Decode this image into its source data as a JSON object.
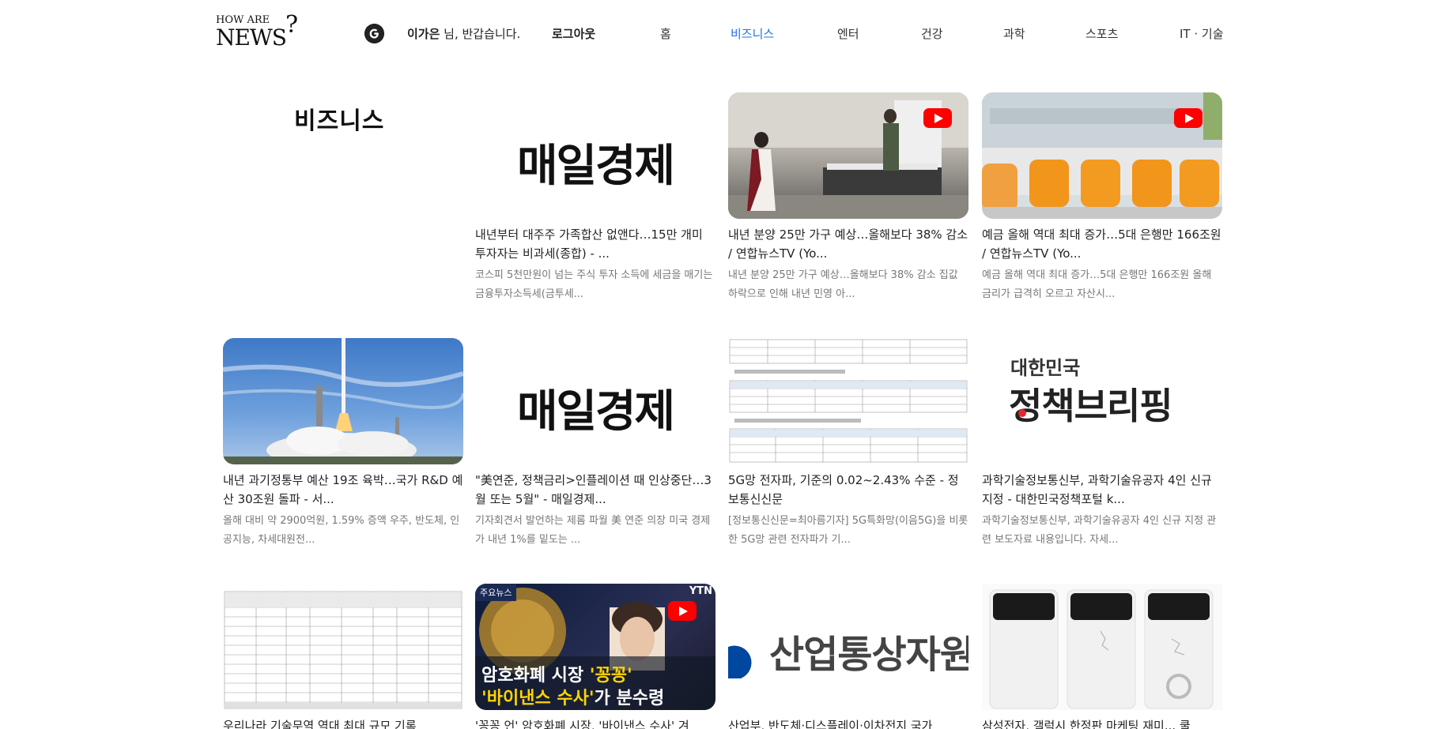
{
  "header": {
    "logo_line1": "HOW ARE",
    "logo_line2": "NEWS",
    "logo_mark": "?",
    "profile_icon": "google-g-icon",
    "user_name": "이가은",
    "greeting_suffix": " 님, 반갑습니다.",
    "logout_label": "로그아웃",
    "nav": [
      {
        "label": "홈",
        "active": false
      },
      {
        "label": "비즈니스",
        "active": true
      },
      {
        "label": "엔터",
        "active": false
      },
      {
        "label": "건강",
        "active": false
      },
      {
        "label": "과학",
        "active": false
      },
      {
        "label": "스포츠",
        "active": false
      },
      {
        "label": "IT · 기술",
        "active": false
      }
    ],
    "active_color": "#1a73e8"
  },
  "section": {
    "title": "비즈니스"
  },
  "cards": [
    {
      "title": "내년부터 대주주 가족합산 없앤다…15만 개미 투자자는 비과세(종합) - ...",
      "desc": "코스피 5천만원이 넘는 주식 투자 소득에 세금을 매기는 금융투자소득세(금투세...",
      "thumb_text": "매일경제",
      "video": false
    },
    {
      "title": "내년 분양 25만 가구 예상…올해보다 38% 감소 / 연합뉴스TV (Yo...",
      "desc": "내년 분양 25만 가구 예상…올해보다 38% 감소 집값 하락으로 인해 내년 민영 아...",
      "thumb_text": "",
      "video": true
    },
    {
      "title": "예금 올해 역대 최대 증가…5대 은행만 166조원 / 연합뉴스TV (Yo...",
      "desc": "예금 올해 역대 최대 증가…5대 은행만 166조원 올해 금리가 급격히 오르고 자산시...",
      "thumb_text": "",
      "video": true
    },
    {
      "title": "내년 과기정통부 예산 19조 육박…국가 R&D 예산 30조원 돌파 - 서...",
      "desc": "올해 대비 약 2900억원, 1.59% 증액 우주, 반도체, 인공지능, 차세대원전...",
      "thumb_text": "",
      "video": false
    },
    {
      "title": "\"美연준, 정책금리>인플레이션 때 인상중단…3월 또는 5월\" - 매일경제...",
      "desc": "기자회견서 발언하는 제롬 파월 美 연준 의장 미국 경제가 내년 1%를 밑도는 ...",
      "thumb_text": "매일경제",
      "video": false
    },
    {
      "title": "5G망 전자파, 기준의 0.02~2.43% 수준 - 정보통신신문",
      "desc": "[정보통신신문=최아름기자] 5G특화망(이음5G)을 비롯한 5G망 관련 전자파가 기...",
      "thumb_text": "",
      "video": false
    },
    {
      "title": "과학기술정보통신부, 과학기술유공자 4인 신규 지정 - 대한민국정책포털 k...",
      "desc": "과학기술정보통신부, 과학기술유공자 4인 신규 지정 관련 보도자료 내용입니다. 자세...",
      "thumb_text_top": "대한민국",
      "thumb_text": "정책브리핑",
      "video": false
    },
    {
      "title": "우리나라 기술무역 역대 최대 규모 기록",
      "desc": "",
      "thumb_text": "",
      "video": false
    },
    {
      "title": "'꽁꽁 언' 암호화폐 시장, '바이낸스 수사' 겨",
      "desc": "",
      "thumb_tag": "주요뉴스",
      "thumb_brand": "YTN",
      "thumb_line1a": "암호화폐 시장 ",
      "thumb_line1b": "'꽁꽁'",
      "thumb_line2a": "'바이낸스 수사'",
      "thumb_line2b": "가 분수령",
      "video": true
    },
    {
      "title": "산업부, 반도체·디스플레이·이차전지 국가",
      "desc": "",
      "thumb_text": "산업통상자원",
      "video": false
    },
    {
      "title": "삼성전자, 갤럭시 한정판 마케팅 재미... 쿨",
      "desc": "",
      "thumb_text": "",
      "video": false
    }
  ]
}
